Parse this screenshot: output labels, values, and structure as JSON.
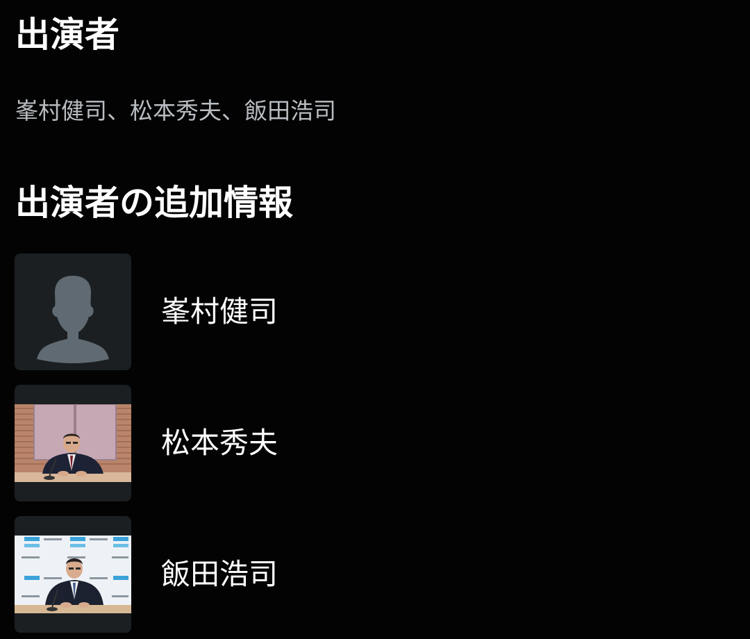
{
  "cast_section": {
    "title": "出演者",
    "names": [
      "峯村健司",
      "松本秀夫",
      "飯田浩司"
    ],
    "separator": "、"
  },
  "extra_section": {
    "title": "出演者の追加情報",
    "members": [
      {
        "name": "峯村健司",
        "thumbnail": "person-placeholder-icon"
      },
      {
        "name": "松本秀夫",
        "thumbnail": "studio-photo"
      },
      {
        "name": "飯田浩司",
        "thumbnail": "press-backdrop-photo"
      }
    ]
  },
  "colors": {
    "background": "#030303",
    "heading": "#ffffff",
    "muted_text": "#b9bdc1",
    "thumb_bg": "#1b1f22",
    "placeholder_icon": "#5f6a72"
  }
}
